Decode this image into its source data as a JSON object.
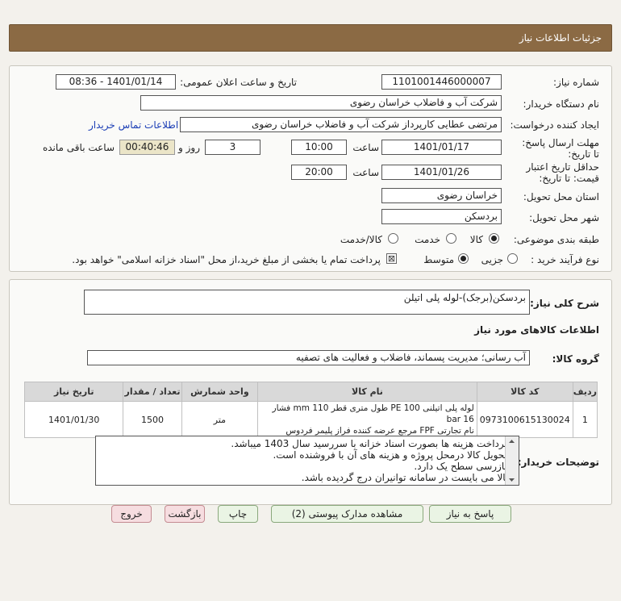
{
  "header": {
    "title": "جزئیات اطلاعات نیاز"
  },
  "form": {
    "need_number_label": "شماره نیاز:",
    "need_number": "1101001446000007",
    "announce_label": "تاریخ و ساعت اعلان عمومی:",
    "announce_value": "1401/01/14 - 08:36",
    "buyer_org_label": "نام دستگاه خریدار:",
    "buyer_org": "شرکت آب و فاضلاب خراسان رضوی",
    "requester_label": "ایجاد کننده درخواست:",
    "requester": "مرتضی عطایی کارپرداز شرکت آب و فاضلاب خراسان رضوی",
    "contact_link": "اطلاعات تماس خریدار",
    "deadline_label": "مهلت ارسال پاسخ: تا تاریخ:",
    "deadline_date": "1401/01/17",
    "time_label": "ساعت",
    "deadline_time": "10:00",
    "days": "3",
    "days_label": "روز و",
    "remaining": "00:40:46",
    "remaining_label": "ساعت باقی مانده",
    "validity_label": "حداقل تاریخ اعتبار قیمت: تا تاریخ:",
    "validity_date": "1401/01/26",
    "validity_time": "20:00",
    "province_label": "استان محل تحویل:",
    "province": "خراسان رضوی",
    "city_label": "شهر محل تحویل:",
    "city": "بردسکن",
    "category_label": "طبقه بندی موضوعی:",
    "category_options": [
      "کالا",
      "خدمت",
      "کالا/خدمت"
    ],
    "process_label": "نوع فرآیند خرید :",
    "process_options": [
      "جزیی",
      "متوسط"
    ],
    "payment_note": "پرداخت تمام یا بخشی از مبلغ خرید،از محل \"اسناد خزانه اسلامی\" خواهد بود."
  },
  "summary": {
    "desc_label": "شرح کلی نیاز:",
    "desc": "بردسکن(برجک)-لوله پلی اتیلن",
    "items_title": "اطلاعات کالاهای مورد نیاز",
    "group_label": "گروه کالا:",
    "group": "آب رسانی؛ مدیریت پسماند، فاضلاب و فعالیت های تصفیه"
  },
  "table": {
    "headers": [
      "ردیف",
      "کد کالا",
      "نام کالا",
      "واحد شمارش",
      "تعداد / مقدار",
      "تاریخ نیاز"
    ],
    "rows": [
      {
        "row": "1",
        "code": "0973100615130024",
        "name_line1": "لوله پلی اتیلنی PE 100 طول متری قطر 110 mm فشار 16 bar",
        "name_line2": "نام تجارتی FPF مرجع عرضه کننده فراز پلیمر فردوس",
        "unit": "متر",
        "qty": "1500",
        "date": "1401/01/30"
      }
    ]
  },
  "buyer_notes": {
    "label": "توضیحات خریدار:",
    "lines": [
      "- پرداخت هزینه ها بصورت اسناد خزانه با سررسید سال 1403 میباشد.",
      "- تحویل کالا درمحل پروژه و هزینه های آن با فروشنده است.",
      "- بازرسی سطح یک دارد.",
      "-کالا می بایست در سامانه توانیران درج گردیده باشد."
    ]
  },
  "buttons": {
    "reply": "پاسخ به نیاز",
    "attachments": "مشاهده مدارک پیوستی (2)",
    "print": "چاپ",
    "back": "بازگشت",
    "exit": "خروج"
  }
}
